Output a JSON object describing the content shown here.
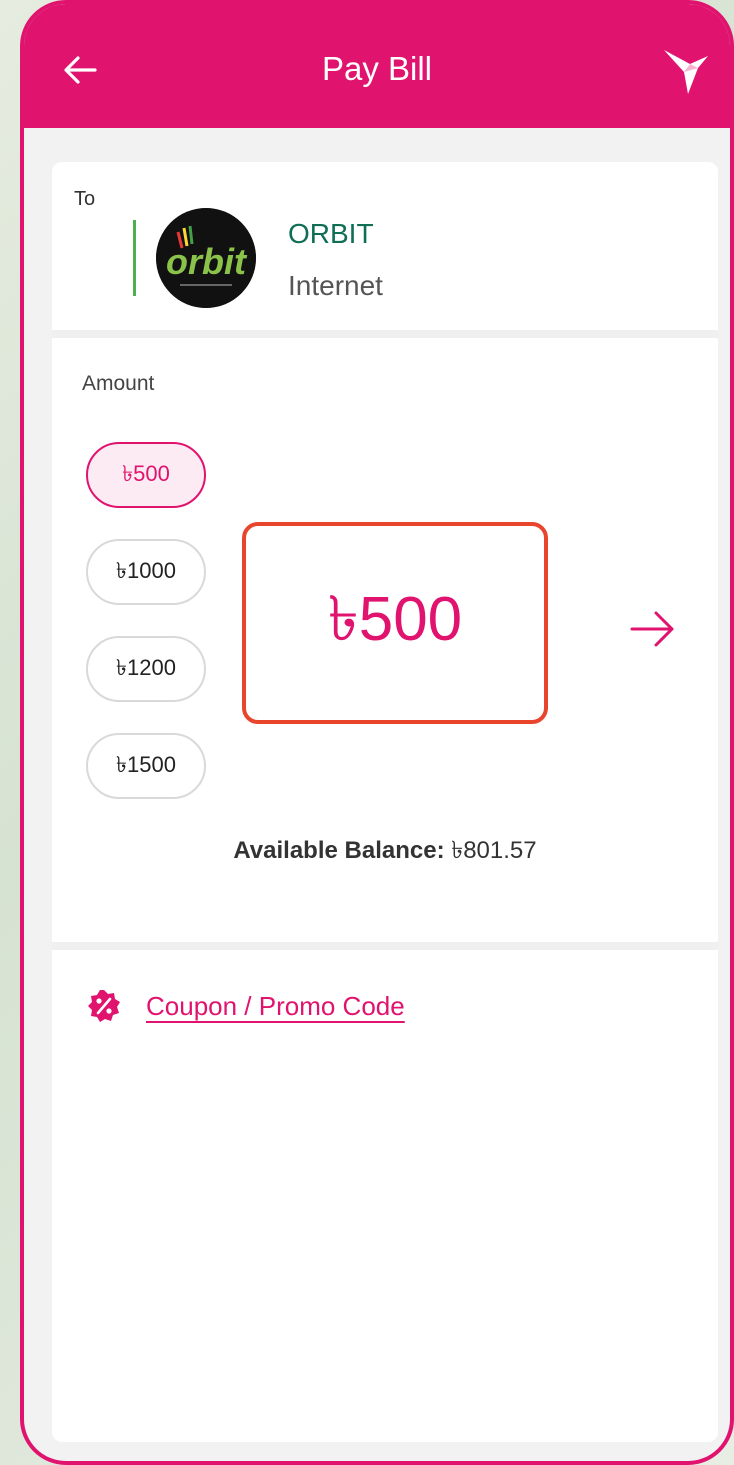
{
  "header": {
    "title": "Pay Bill",
    "back_icon": "arrow-left-icon",
    "brand_icon": "bird-logo-icon"
  },
  "recipient": {
    "to_label": "To",
    "name": "ORBIT",
    "type": "Internet",
    "logo_text": "orbit"
  },
  "amount": {
    "label": "Amount",
    "selected_value": "৳500",
    "chips": [
      "৳500",
      "৳1000",
      "৳1200",
      "৳1500"
    ],
    "selected_index": 0
  },
  "balance": {
    "label": "Available Balance:",
    "value": "৳801.57"
  },
  "coupon": {
    "label": "Coupon / Promo Code"
  },
  "colors": {
    "brand": "#e0136f",
    "highlight_border": "#e8452c",
    "biller_name": "#0f6e54"
  }
}
